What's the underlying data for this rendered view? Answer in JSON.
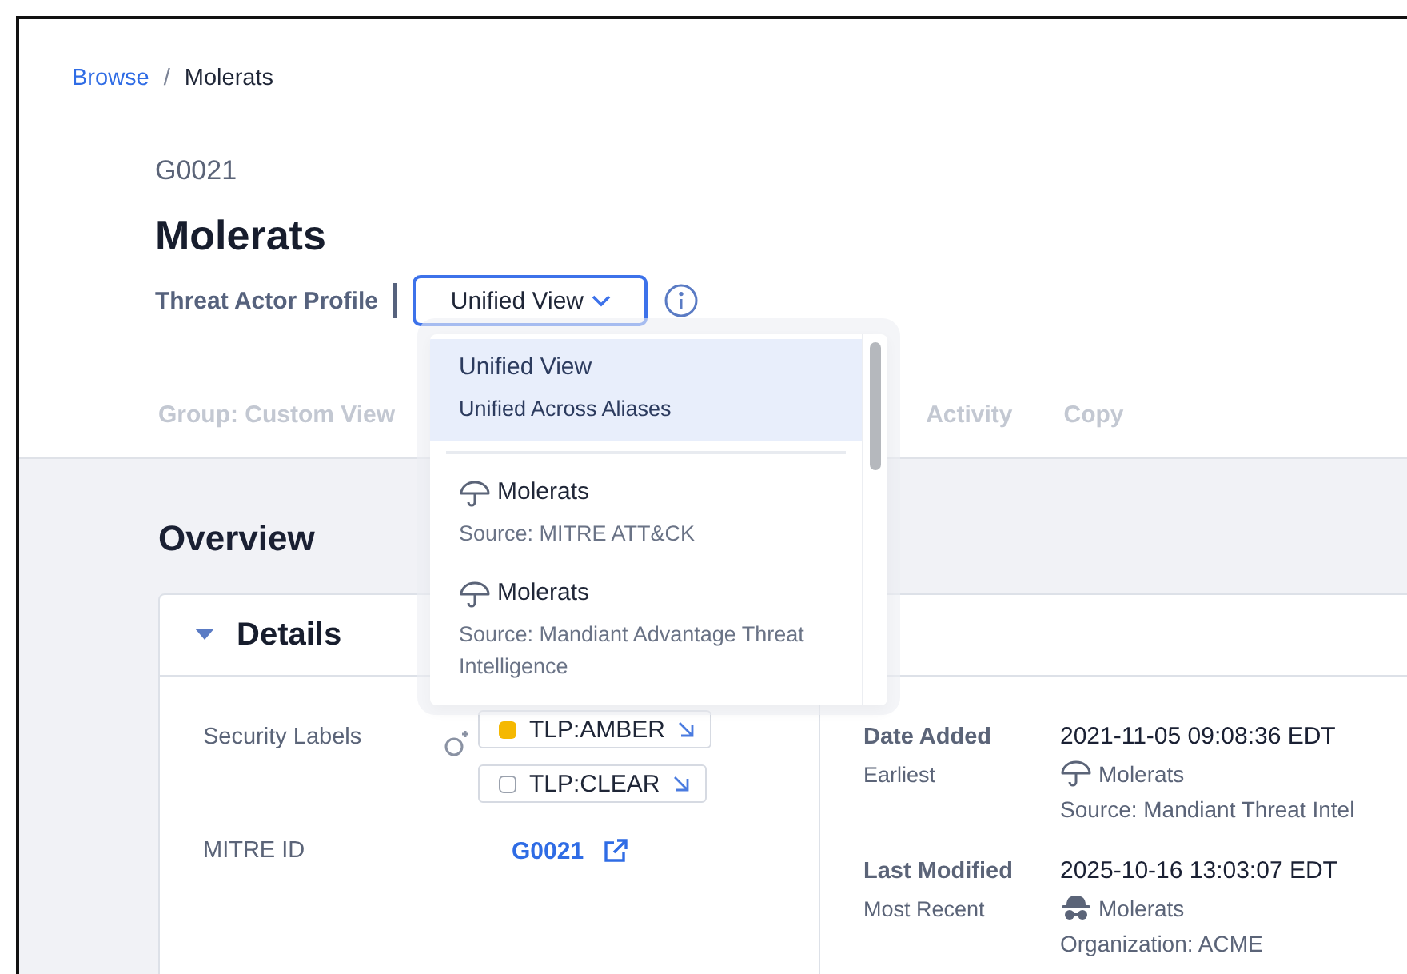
{
  "breadcrumb": [
    {
      "label": "Browse",
      "kind": "link"
    },
    {
      "label": "Molerats",
      "kind": "current"
    }
  ],
  "breadcrumb_separator": "/",
  "header": {
    "id": "G0021",
    "title": "Molerats",
    "subtitle": "Threat Actor Profile",
    "view_select": {
      "value": "Unified View",
      "expanded": true
    }
  },
  "tabs": [
    {
      "label": "Group: Custom View"
    },
    {
      "label": "Activity"
    },
    {
      "label": "Copy"
    }
  ],
  "view_options": [
    {
      "kind": "unified",
      "title": "Unified View",
      "subtitle": "Unified Across Aliases",
      "selected": true
    },
    {
      "kind": "source",
      "title": "Molerats",
      "subtitle": "Source: MITRE ATT&CK",
      "selected": false
    },
    {
      "kind": "source",
      "title": "Molerats",
      "subtitle": "Source: Mandiant Advantage Threat Intelligence",
      "selected": false
    }
  ],
  "overview": {
    "title": "Overview",
    "details": {
      "title": "Details",
      "expanded": true,
      "security_labels": {
        "label": "Security Labels",
        "tags": [
          {
            "label": "TLP:AMBER",
            "color": "#f5b800"
          },
          {
            "label": "TLP:CLEAR",
            "color": "#ffffff"
          }
        ]
      },
      "mitre_id": {
        "label": "MITRE ID",
        "value": "G0021"
      },
      "dates": [
        {
          "label": "Date Added",
          "sublabel": "Earliest",
          "value": "2021-11-05 09:08:36 EDT",
          "actor": "Molerats",
          "kind": "source",
          "origin": "Source: Mandiant Threat Intel"
        },
        {
          "label": "Last Modified",
          "sublabel": "Most Recent",
          "value": "2025-10-16 13:03:07 EDT",
          "actor": "Molerats",
          "kind": "organization",
          "origin": "Organization: ACME"
        }
      ]
    }
  }
}
